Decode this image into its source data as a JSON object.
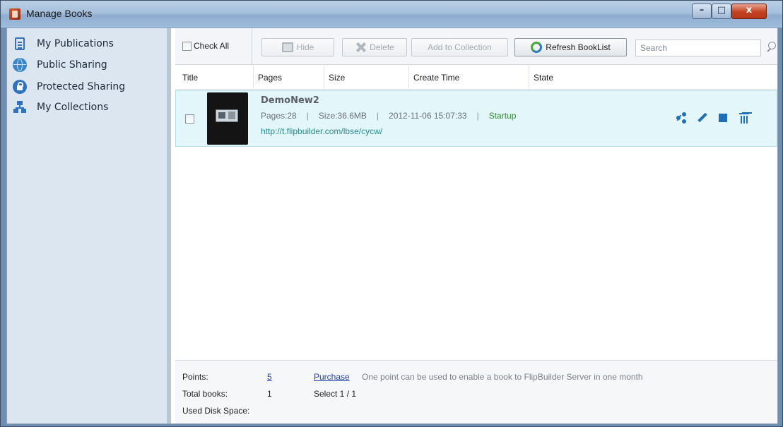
{
  "window": {
    "title": "Manage Books",
    "minimize_glyph": "–",
    "maximize_glyph": "□",
    "close_glyph": "x"
  },
  "sidebar": {
    "items": [
      {
        "label": "My Publications",
        "icon": "publications-icon"
      },
      {
        "label": "Public Sharing",
        "icon": "globe-icon"
      },
      {
        "label": "Protected Sharing",
        "icon": "lock-icon"
      },
      {
        "label": "My Collections",
        "icon": "collections-icon"
      }
    ]
  },
  "toolbar": {
    "check_all_label": "Check All",
    "hide_label": "Hide",
    "delete_label": "Delete",
    "add_to_collection_label": "Add to Collection",
    "refresh_label": "Refresh BookList",
    "search_placeholder": "Search"
  },
  "columns": [
    "Title",
    "Pages",
    "Size",
    "Create Time",
    "State"
  ],
  "books": [
    {
      "title": "DemoNew2",
      "pages": "Pages:28",
      "size": "Size:36.6MB",
      "create_time": "2012-11-06 15:07:33",
      "state": "Startup",
      "url": "http://t.flipbuilder.com/lbse/cycw/",
      "separator": "|"
    }
  ],
  "footer": {
    "points_label": "Points:",
    "points_value": "5",
    "purchase_label": "Purchase",
    "points_note": "One point can be used to enable a book to FlipBuilder Server in one month",
    "total_books_label": "Total books:",
    "total_books_value": "1",
    "select_text": "Select 1 / 1",
    "disk_space_label": "Used Disk Space:"
  },
  "colors": {
    "selected_row": "#e3f6fa",
    "state_green": "#2e8b2e",
    "link_blue": "#1f3fb0",
    "action_icon_blue": "#1f6fb8"
  }
}
